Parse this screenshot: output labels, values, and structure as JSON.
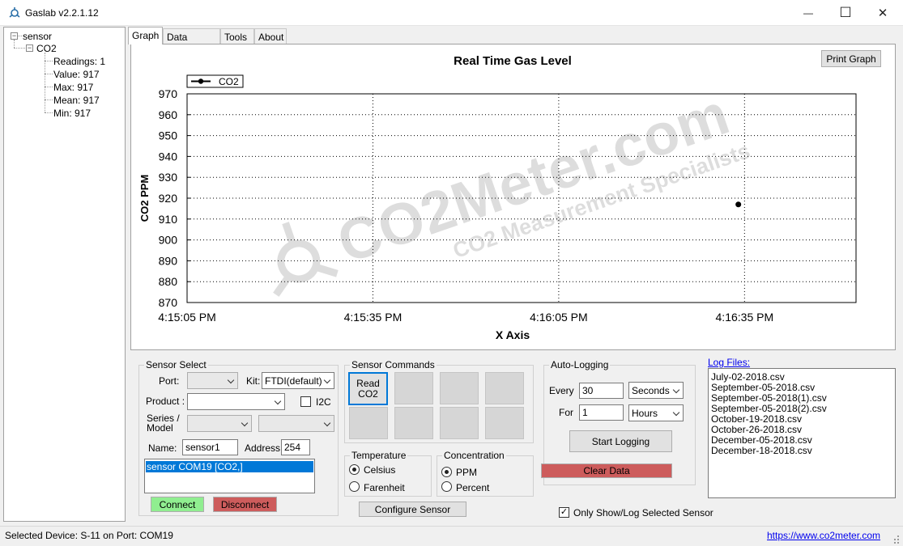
{
  "window": {
    "title": "Gaslab v2.2.1.12",
    "minimize_glyph": "—",
    "maximize_glyph": "☐",
    "close_glyph": "✕"
  },
  "tree": {
    "root": "sensor",
    "child": "CO2",
    "items": [
      "Readings: 1",
      "Value: 917",
      "Max: 917",
      "Mean: 917",
      "Min: 917"
    ],
    "expand_glyph": "−"
  },
  "tabs": [
    "Graph",
    "Data Stream",
    "Tools",
    "About"
  ],
  "graph": {
    "print_button": "Print Graph"
  },
  "chart_data": {
    "type": "scatter",
    "title": "Real Time Gas Level",
    "xlabel": "X Axis",
    "ylabel": "CO2 PPM",
    "legend": "top-left",
    "grid": true,
    "ylim": [
      870,
      970
    ],
    "yticks": [
      "970",
      "960",
      "950",
      "940",
      "930",
      "920",
      "910",
      "900",
      "890",
      "880",
      "870"
    ],
    "xlim": [
      "4:15:05 PM",
      "4:16:53 PM"
    ],
    "xticks": [
      "4:15:05 PM",
      "4:15:35 PM",
      "4:16:05 PM",
      "4:16:35 PM"
    ],
    "series": [
      {
        "name": "CO2",
        "color": "#000000",
        "points": [
          {
            "x": "4:16:34 PM",
            "y": 917
          }
        ]
      }
    ]
  },
  "watermark": {
    "main": "CO2Meter.com",
    "sub": "CO2 Measurement Specialists"
  },
  "sensor_select": {
    "legend": "Sensor Select",
    "port_label": "Port:",
    "port_value": "",
    "kit_label": "Kit:",
    "kit_value": "FTDI(default)",
    "product_label": "Product :",
    "product_value": "",
    "i2c_label": "I2C",
    "series_label": "Series /\nModel",
    "name_label": "Name:",
    "name_value": "sensor1",
    "address_label": "Address:",
    "address_value": "254",
    "list_items": [
      "sensor COM19 [CO2,]"
    ],
    "connect": "Connect",
    "disconnect": "Disconnect"
  },
  "sensor_commands": {
    "legend": "Sensor Commands",
    "read_button": "Read\nCO2",
    "temperature": {
      "legend": "Temperature",
      "options": [
        "Celsius",
        "Farenheit"
      ],
      "selected": "Celsius"
    },
    "concentration": {
      "legend": "Concentration",
      "options": [
        "PPM",
        "Percent"
      ],
      "selected": "PPM"
    },
    "configure": "Configure Sensor"
  },
  "auto_logging": {
    "legend": "Auto-Logging",
    "every_label": "Every",
    "every_value": "30",
    "every_unit": "Seconds",
    "for_label": "For",
    "for_value": "1",
    "for_unit": "Hours",
    "start": "Start Logging",
    "clear": "Clear Data",
    "only_show_label": "Only Show/Log Selected Sensor",
    "only_show_checked": true
  },
  "log_files": {
    "label": "Log Files:",
    "files": [
      "July-02-2018.csv",
      "September-05-2018.csv",
      "September-05-2018(1).csv",
      "September-05-2018(2).csv",
      "October-19-2018.csv",
      "October-26-2018.csv",
      "December-05-2018.csv",
      "December-18-2018.csv"
    ]
  },
  "status": {
    "device": "Selected Device: S-11 on Port: COM19",
    "link": "https://www.co2meter.com"
  },
  "colors": {
    "connect": "#90ee90",
    "disconnect": "#cd5c5c",
    "clear": "#cd5c5c",
    "selection": "#0078d7",
    "link": "#0000ee"
  }
}
